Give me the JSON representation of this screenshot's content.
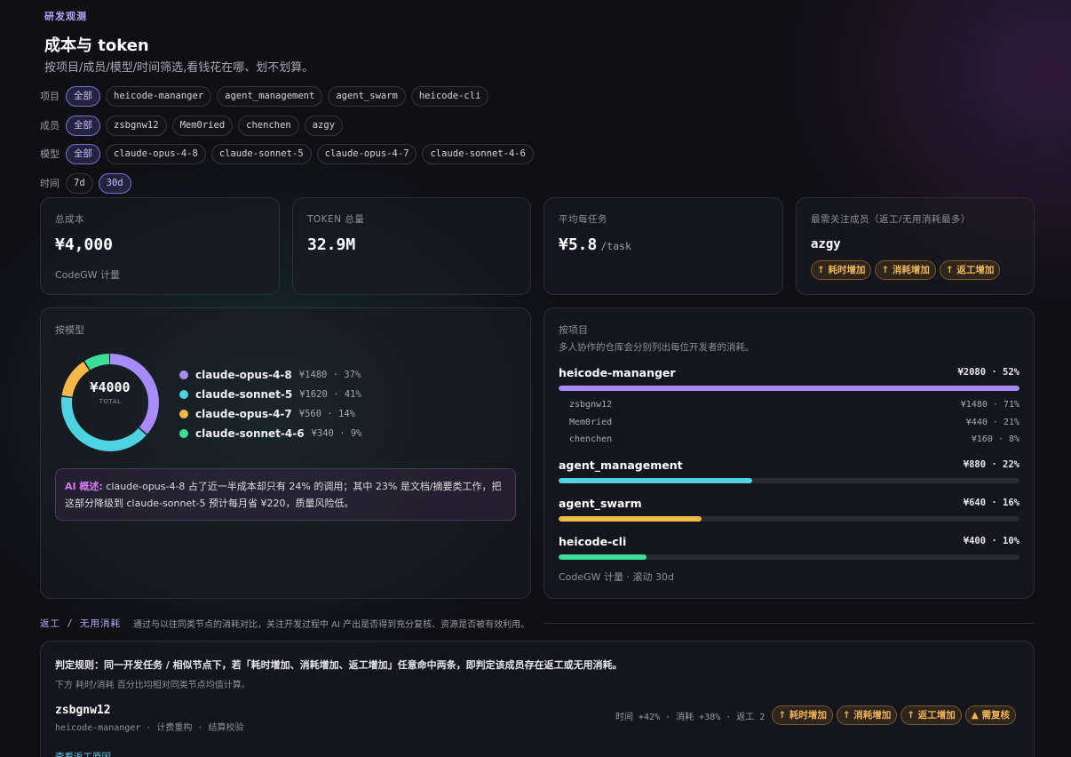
{
  "header": {
    "eyebrow": "研发观测",
    "title": "成本与 token",
    "subtitle": "按项目/成员/模型/时间筛选,看钱花在哪、划不划算。"
  },
  "filters": {
    "project": {
      "label": "项目",
      "options": [
        "全部",
        "heicode-mananger",
        "agent_management",
        "agent_swarm",
        "heicode-cli"
      ],
      "active": "全部"
    },
    "member": {
      "label": "成员",
      "options": [
        "全部",
        "zsbgnw12",
        "Mem0ried",
        "chenchen",
        "azgy"
      ],
      "active": "全部"
    },
    "model": {
      "label": "模型",
      "options": [
        "全部",
        "claude-opus-4-8",
        "claude-sonnet-5",
        "claude-opus-4-7",
        "claude-sonnet-4-6"
      ],
      "active": "全部"
    },
    "time": {
      "label": "时间",
      "options": [
        "7d",
        "30d"
      ],
      "active": "30d"
    }
  },
  "kpis": {
    "total_cost": {
      "label": "总成本",
      "value": "¥4,000",
      "sub": "CodeGW 计量"
    },
    "tokens": {
      "label": "TOKEN 总量",
      "value": "32.9M"
    },
    "avg_task": {
      "label": "平均每任务",
      "value": "¥5.8",
      "unit": "/task"
    },
    "attention": {
      "label": "最需关注成员（返工/无用消耗最多）",
      "name": "azgy",
      "tags": [
        "↑ 耗时增加",
        "↑ 消耗增加",
        "↑ 返工增加"
      ]
    }
  },
  "by_model": {
    "title": "按模型",
    "total": "¥4000",
    "total_caption": "TOTAL",
    "items": [
      {
        "name": "claude-opus-4-8",
        "value": "¥1480 · 37%",
        "share": 37,
        "color": "#a78bfa"
      },
      {
        "name": "claude-sonnet-5",
        "value": "¥1620 · 41%",
        "share": 41,
        "color": "#4dd4e0"
      },
      {
        "name": "claude-opus-4-7",
        "value": "¥560 · 14%",
        "share": 14,
        "color": "#f5b849"
      },
      {
        "name": "claude-sonnet-4-6",
        "value": "¥340 · 9%",
        "share": 9,
        "color": "#3ddc97"
      }
    ],
    "ai_label": "AI 概述:",
    "ai_text": "claude-opus-4-8 占了近一半成本却只有 24% 的调用；其中 23% 是文档/摘要类工作，把这部分降级到 claude-sonnet-5 预计每月省 ¥220，质量风险低。"
  },
  "by_project": {
    "title": "按项目",
    "desc": "多人协作的仓库会分别列出每位开发者的消耗。",
    "projects": [
      {
        "name": "heicode-mananger",
        "value": "¥2080 · 52%",
        "share": 100,
        "color": "#a78bfa",
        "members": [
          {
            "name": "zsbgnw12",
            "value": "¥1480 · 71%"
          },
          {
            "name": "Mem0ried",
            "value": "¥440 · 21%"
          },
          {
            "name": "chenchen",
            "value": "¥160 · 8%"
          }
        ]
      },
      {
        "name": "agent_management",
        "value": "¥880 · 22%",
        "share": 42,
        "color": "#4dd4e0",
        "members": []
      },
      {
        "name": "agent_swarm",
        "value": "¥640 · 16%",
        "share": 31,
        "color": "#f5b849",
        "members": []
      },
      {
        "name": "heicode-cli",
        "value": "¥400 · 10%",
        "share": 19,
        "color": "#3ddc97",
        "members": []
      }
    ],
    "footer": "CodeGW 计量 · 滚动 30d"
  },
  "rework": {
    "title": "返工 / 无用消耗",
    "desc": "通过与以往同类节点的消耗对比，关注开发过程中 AI 产出是否得到充分复核、资源是否被有效利用。",
    "rule": "判定规则：同一开发任务 / 相似节点下，若「耗时增加、消耗增加、返工增加」任意命中两条，即判定该成员存在返工或无用消耗。",
    "rule_sub": "下方 耗时/消耗 百分比均相对同类节点均值计算。",
    "member": {
      "name": "zsbgnw12",
      "meta": "heicode-mananger · 计费重构 · 结算校验",
      "stats": "时间 +42% · 消耗 +38% · 返工 2",
      "tags": [
        "↑ 耗时增加",
        "↑ 消耗增加",
        "↑ 返工增加",
        "▲ 需复核"
      ]
    },
    "link": "查看返工原因"
  }
}
